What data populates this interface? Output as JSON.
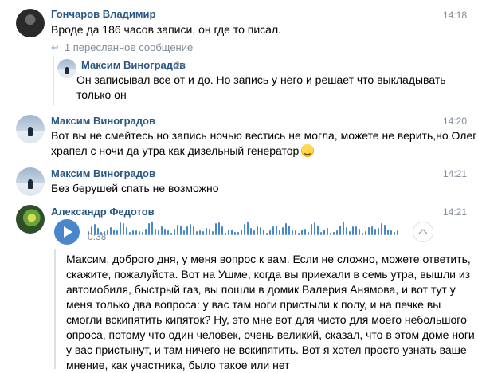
{
  "messages": [
    {
      "author": "Гончаров Владимир",
      "time": "14:18",
      "lines": [
        "Вроде да 186 часов записи, он где то писал."
      ],
      "forwarded": {
        "label": "1 пересланное сообщение",
        "author": "Максим Виноградов",
        "time": "2ч",
        "lines": [
          "Он записывал все от и до. Но запись у него и решает что выкладывать",
          "только он"
        ]
      }
    },
    {
      "author": "Максим Виноградов",
      "time": "14:20",
      "lines": [
        "Вот вы не смейтесь,но запись ночью вестись не могла, можете не верить,но Олег",
        "храпел с ночи да утра как дизельный генератор"
      ]
    },
    {
      "author": "Максим Виноградов",
      "time": "14:21",
      "lines": [
        "Без берушей спать не возможно"
      ]
    },
    {
      "author": "Александр Федотов",
      "time": "14:21",
      "voice": {
        "duration": "0:38",
        "transcript": [
          "Максим, доброго дня, у меня вопрос к вам. Если не сложно, можете ответить,",
          "скажите, пожалуйста. Вот на Ушме, когда вы приехали в семь утра, вышли из",
          "автомобиля, быстрый газ, вы пошли в домик Валерия Анямова, и вот тут у",
          "меня только два вопроса: у вас там ноги пристыли к полу, и на печке вы",
          "смогли вскипятить кипяток? Ну, это мне вот для чисто для моего небольшого",
          "опроса, потому что один человек, очень великий, сказал, что в этом доме ноги",
          "у вас пристынут, и там ничего не вскипятить. Вот я хотел просто узнать ваше",
          "мнение, как участника, было такое или нет"
        ]
      }
    }
  ],
  "colors": {
    "accent": "#4986cc",
    "name": "#2a5885",
    "muted": "#818c99"
  }
}
